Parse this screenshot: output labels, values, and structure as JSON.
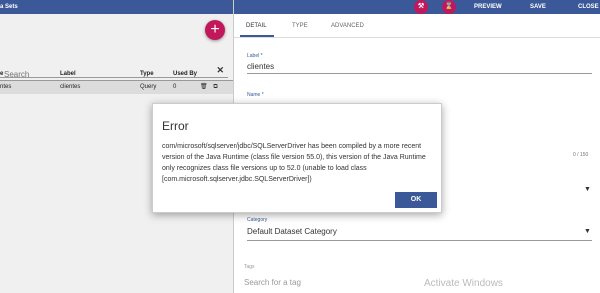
{
  "left_panel": {
    "toolbar_title": "a Sets",
    "add_icon": "+",
    "search": {
      "placeholder": "Search",
      "clear": "✕"
    },
    "table": {
      "headers": [
        "e",
        "Label",
        "Type",
        "Used By"
      ],
      "rows": [
        {
          "name": "ntes",
          "label": "clientes",
          "type": "Query",
          "used_by": "0",
          "delete_icon": "🗑",
          "copy_icon": "⧉"
        }
      ]
    }
  },
  "right_panel": {
    "actions": {
      "preview": "PREVIEW",
      "save": "SAVE",
      "close": "CLOSE",
      "icon1": "⚒",
      "icon2": "⌛"
    },
    "tabs": [
      "DETAIL",
      "TYPE",
      "ADVANCED"
    ],
    "fields": {
      "label": {
        "label": "Label *",
        "value": "clientes"
      },
      "name": {
        "label": "Name *",
        "value": ""
      },
      "counter": "0 / 150",
      "category": {
        "label": "Category",
        "value": "Default Dataset Category"
      },
      "tags": {
        "label": "Tags",
        "placeholder": "Search for a tag"
      }
    }
  },
  "dialog": {
    "title": "Error",
    "message": "com/microsoft/sqlserver/jdbc/SQLServerDriver has been compiled by a more recent version of the Java Runtime (class file version 55.0), this version of the Java Runtime only recognizes class file versions up to 52.0 (unable to load class [com.microsoft.sqlserver.jdbc.SQLServerDriver])",
    "ok_label": "OK"
  },
  "watermark": "Activate Windows",
  "colors": {
    "primary": "#3b5998",
    "accent": "#c2185b"
  }
}
